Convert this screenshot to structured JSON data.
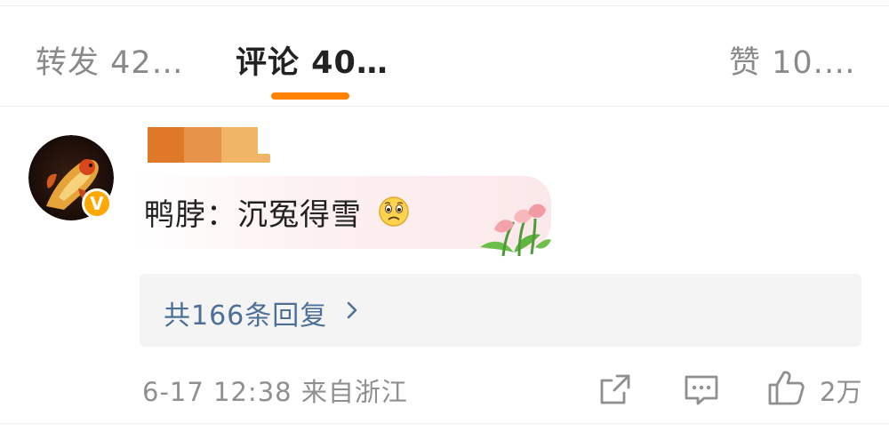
{
  "tabs": {
    "reposts_label": "转发 42…",
    "comments_label": "评论 40…",
    "likes_label": "赞 10.…",
    "active": "comments"
  },
  "comment": {
    "text": "鸭脖：沉冤得雪",
    "emoji_icon": "sad-face-emoji-icon",
    "sticker_icon": "tulips-sticker-icon",
    "username_colors": [
      "#e0782a",
      "#e8934a",
      "#f0b566"
    ],
    "verified_badge": "V",
    "replies_label": "共166条回复",
    "timestamp": "6-17 12:38",
    "source": "来自浙江",
    "like_count": "2万"
  },
  "colors": {
    "accent": "#ff8200",
    "link": "#4b6f96",
    "muted": "#8f8f8f"
  }
}
